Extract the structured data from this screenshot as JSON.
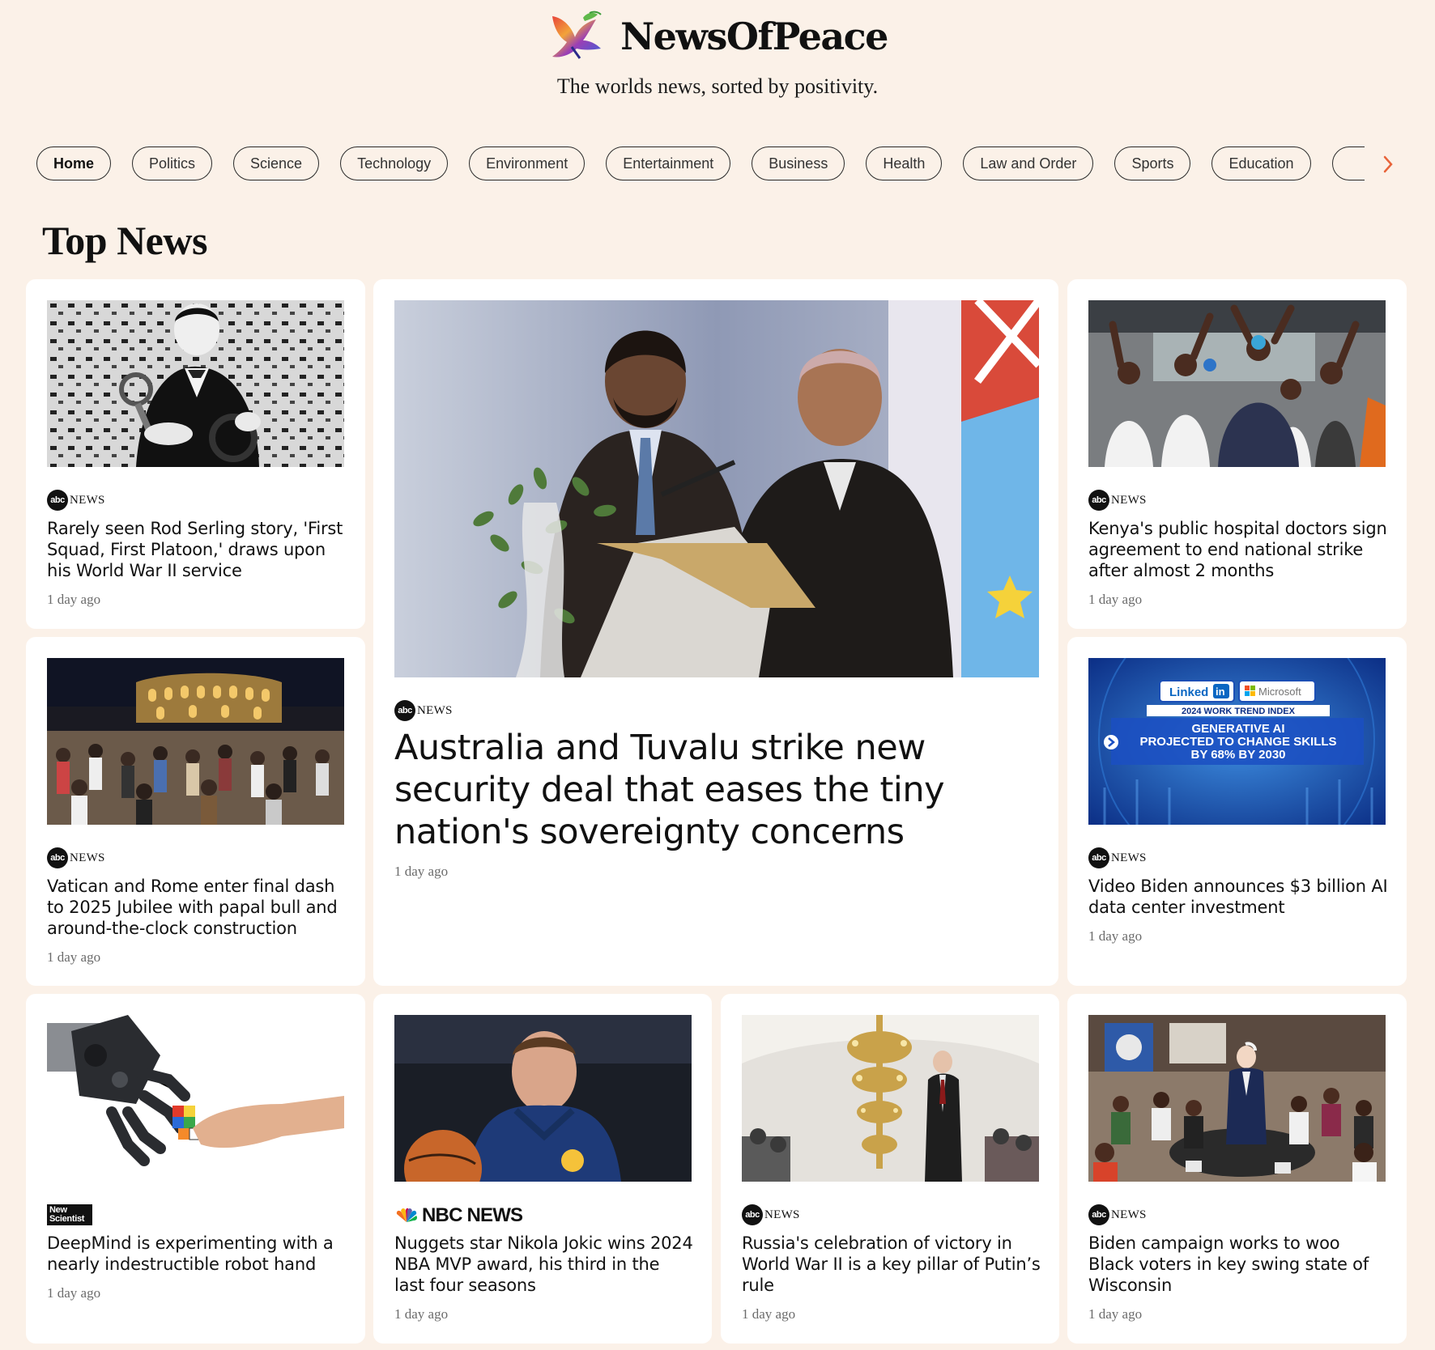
{
  "brand": {
    "name": "NewsOfPeace",
    "tagline": "The worlds news, sorted by positivity."
  },
  "nav": {
    "items": [
      "Home",
      "Politics",
      "Science",
      "Technology",
      "Environment",
      "Entertainment",
      "Business",
      "Health",
      "Law and Order",
      "Sports",
      "Education",
      ""
    ],
    "active": "Home",
    "next_icon": "chevron-right-icon"
  },
  "section": {
    "title": "Top News"
  },
  "sources": {
    "abc_mark": "abc",
    "abc_word": "NEWS",
    "nbc_word": "NBC NEWS",
    "newscientist_line1": "New",
    "newscientist_line2": "Scientist"
  },
  "thumb_text": {
    "linkedin": "Linked",
    "linkedin_in": "in",
    "microsoft": "Microsoft",
    "trend": "2024 WORK TREND INDEX",
    "line1": "GENERATIVE AI",
    "line2": "PROJECTED TO CHANGE SKILLS",
    "line3": "BY 68% BY 2030"
  },
  "articles": [
    {
      "id": "serling",
      "source": "abc",
      "headline": "Rarely seen Rod Serling story, 'First Squad, First Platoon,' draws upon his World War II service",
      "time": "1 day ago"
    },
    {
      "id": "tuvalu",
      "source": "abc",
      "headline": "Australia and Tuvalu strike new security deal that eases the tiny nation's sovereignty concerns",
      "time": "1 day ago"
    },
    {
      "id": "kenya",
      "source": "abc",
      "headline": "Kenya's public hospital doctors sign agreement to end national strike after almost 2 months",
      "time": "1 day ago"
    },
    {
      "id": "vatican",
      "source": "abc",
      "headline": "Vatican and Rome enter final dash to 2025 Jubilee with papal bull and around-the-clock construction",
      "time": "1 day ago"
    },
    {
      "id": "biden-ai",
      "source": "abc",
      "headline": "Video Biden announces $3 billion AI data center investment",
      "time": "1 day ago"
    },
    {
      "id": "deepmind",
      "source": "newscientist",
      "headline": "DeepMind is experimenting with a nearly indestructible robot hand",
      "time": "1 day ago"
    },
    {
      "id": "jokic",
      "source": "nbc",
      "headline": "Nuggets star Nikola Jokic wins 2024 NBA MVP award, his third in the last four seasons",
      "time": "1 day ago"
    },
    {
      "id": "russia",
      "source": "abc",
      "headline": "Russia's celebration of victory in World War II is a key pillar of Putin’s rule",
      "time": "1 day ago"
    },
    {
      "id": "wisconsin",
      "source": "abc",
      "headline": "Biden campaign works to woo Black voters in key swing state of Wisconsin",
      "time": "1 day ago"
    }
  ],
  "colors": {
    "background": "#fbf1e8",
    "card": "#ffffff",
    "text": "#111111",
    "muted": "#6b6b6b",
    "accent": "#e8643a"
  }
}
